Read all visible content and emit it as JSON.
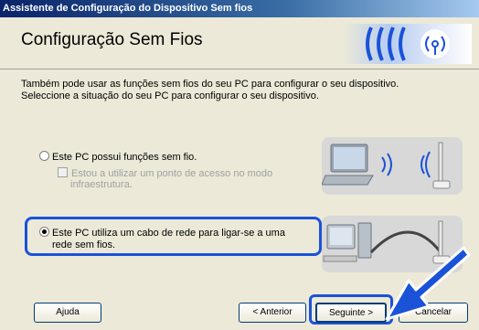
{
  "window": {
    "title": "Assistente de Configuração do Dispositivo Sem fios"
  },
  "header": {
    "title": "Configuração Sem Fios"
  },
  "description": {
    "line1": "Também pode usar as funções sem fios do seu PC para configurar o seu dispositivo.",
    "line2": "Seleccione a situação do seu PC para configurar o seu dispositivo."
  },
  "options": {
    "wireless_pc": {
      "label": "Este PC possui funções sem fio.",
      "selected": false
    },
    "access_point": {
      "line1": "Estou a utilizar um ponto de acesso no modo",
      "line2": "infraestrutura.",
      "checked": false,
      "enabled": false
    },
    "cable_pc": {
      "line1": "Este  PC utiliza um cabo de rede para ligar-se a uma",
      "line2": "rede sem fios.",
      "selected": true
    }
  },
  "buttons": {
    "help": "Ajuda",
    "back": "< Anterior",
    "next": "Seguinte >",
    "cancel": "Cancelar"
  },
  "colors": {
    "highlight": "#1a52d8",
    "titlebar": "#0a246a",
    "logo": "#1a52d8"
  }
}
